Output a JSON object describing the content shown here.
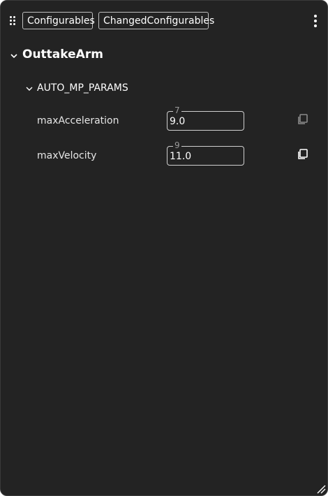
{
  "toolbar": {
    "drag_icon": "drag-dots-icon",
    "tabs": [
      {
        "label": "Configurables"
      },
      {
        "label": "ChangedConfigurables"
      }
    ],
    "menu_icon": "more-vertical-icon"
  },
  "section": {
    "title": "OuttakeArm",
    "group": {
      "title": "AUTO_MP_PARAMS",
      "params": [
        {
          "label": "maxAcceleration",
          "previous": "7",
          "value": "9.0",
          "copy_icon": "copy-icon",
          "copy_color": "#8a8a8a"
        },
        {
          "label": "maxVelocity",
          "previous": "9",
          "value": "11.0",
          "copy_icon": "copy-icon",
          "copy_color": "#ffffff"
        }
      ]
    }
  },
  "colors": {
    "panel_bg": "#232323",
    "text": "#e6e6e6",
    "border": "#d0d0d0"
  }
}
